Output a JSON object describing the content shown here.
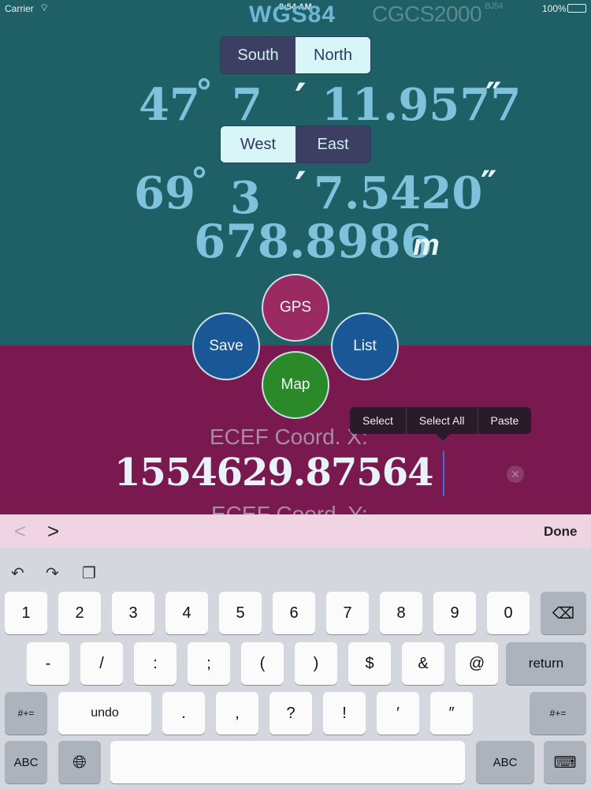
{
  "status_bar": {
    "carrier": "Carrier",
    "time": "8:54 AM",
    "battery": "100%"
  },
  "datums": {
    "primary": "WGS84",
    "secondary": "CGCS2000",
    "secondary_suffix": "BJ54"
  },
  "latitude": {
    "options": [
      "South",
      "North"
    ],
    "selected": "South",
    "degrees": "47",
    "deg_symbol": "°",
    "minutes": "7",
    "min_symbol": "′",
    "seconds": "11.9577",
    "sec_symbol": "″"
  },
  "longitude": {
    "options": [
      "West",
      "East"
    ],
    "selected": "East",
    "degrees": "69",
    "deg_symbol": "°",
    "minutes": "3",
    "min_symbol": "′",
    "seconds": "7.5420",
    "sec_symbol": "″"
  },
  "altitude": {
    "value": "678.8986",
    "unit": "m"
  },
  "actions": {
    "gps": "GPS",
    "save": "Save",
    "list": "List",
    "map": "Map"
  },
  "ecef": {
    "x_label": "ECEF Coord. X:",
    "x_value": "1554629.87564",
    "y_label": "ECEF Coord. Y:"
  },
  "context_menu": [
    "Select",
    "Select All",
    "Paste"
  ],
  "accessory": {
    "prev": "<",
    "next": ">",
    "done": "Done"
  },
  "keyboard": {
    "row1": [
      "1",
      "2",
      "3",
      "4",
      "5",
      "6",
      "7",
      "8",
      "9",
      "0"
    ],
    "row2": [
      "-",
      "/",
      ":",
      ";",
      "(",
      ")",
      "$",
      "&",
      "@"
    ],
    "row3": [
      "undo",
      ".",
      ",",
      "?",
      "!",
      "′",
      "″"
    ],
    "return": "return",
    "shift_symbols": "#+=",
    "abc": "ABC"
  },
  "colors": {
    "top_bg": "#1f6066",
    "bottom_bg": "#7a1850",
    "accent_text": "#7ec2dc"
  }
}
